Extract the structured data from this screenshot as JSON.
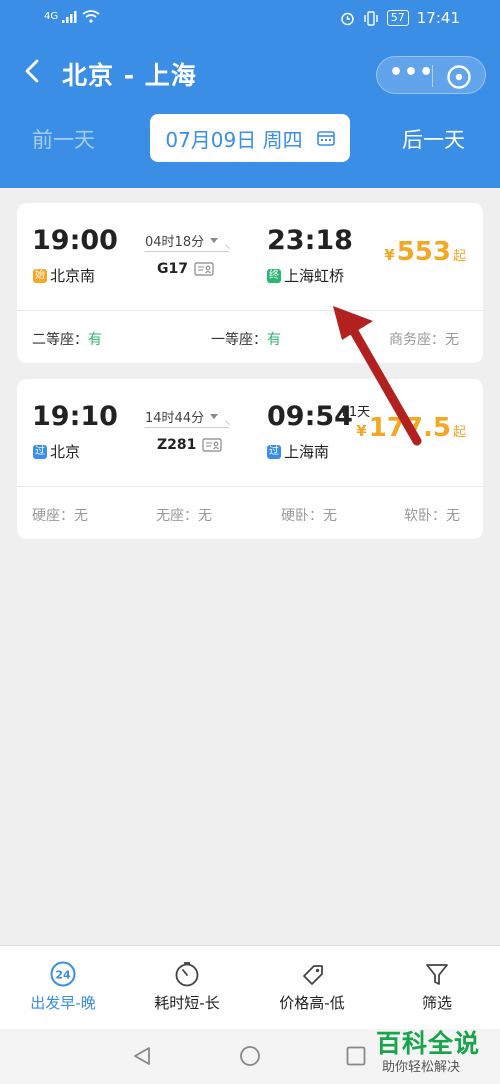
{
  "status_bar": {
    "network": "4G",
    "battery": "57",
    "time": "17:41"
  },
  "header": {
    "title": "北京 - 上海",
    "prev_day": "前一天",
    "next_day": "后一天",
    "date": "07月09日 周四"
  },
  "trains": [
    {
      "dep_time": "19:00",
      "dep_tag": "始",
      "dep_station": "北京南",
      "duration": "04时18分",
      "train_no": "G17",
      "arr_time": "23:18",
      "arr_tag": "终",
      "arr_station": "上海虹桥",
      "plus_day": "",
      "price_symbol": "¥",
      "price": "553",
      "price_suffix": "起",
      "seats": [
        {
          "label": "二等座：",
          "value": "有"
        },
        {
          "label": "一等座：",
          "value": "有"
        },
        {
          "label": "商务座：",
          "value": "无"
        }
      ]
    },
    {
      "dep_time": "19:10",
      "dep_tag": "过",
      "dep_station": "北京",
      "duration": "14时44分",
      "train_no": "Z281",
      "arr_time": "09:54",
      "arr_tag": "过",
      "arr_station": "上海南",
      "plus_day": "+1天",
      "price_symbol": "¥",
      "price": "177.5",
      "price_suffix": "起",
      "seats": [
        {
          "label": "硬座：",
          "value": "无"
        },
        {
          "label": "无座：",
          "value": "无"
        },
        {
          "label": "硬卧：",
          "value": "无"
        },
        {
          "label": "软卧：",
          "value": "无"
        }
      ]
    }
  ],
  "bottom_tabs": [
    {
      "label": "出发早-晚",
      "icon": "clock-24-icon",
      "icon_text": "24"
    },
    {
      "label": "耗时短-长",
      "icon": "stopwatch-icon"
    },
    {
      "label": "价格高-低",
      "icon": "price-tag-icon"
    },
    {
      "label": "筛选",
      "icon": "filter-icon"
    }
  ],
  "watermark": {
    "title": "百科全说",
    "subtitle": "助你轻松解决"
  },
  "colors": {
    "primary": "#3a8ee6",
    "price": "#f5a623",
    "available": "#2bb673",
    "annotation_arrow": "#b32020"
  }
}
